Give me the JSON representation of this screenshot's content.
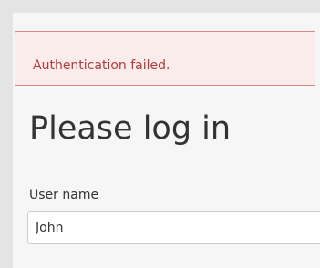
{
  "alert": {
    "message": "Authentication failed."
  },
  "page": {
    "title": "Please log in"
  },
  "username": {
    "label": "User name",
    "value": "John"
  },
  "colors": {
    "alert_background": "#fbecec",
    "alert_border": "#e08585",
    "alert_text": "#b33a3a",
    "page_background": "#f6f6f6"
  }
}
